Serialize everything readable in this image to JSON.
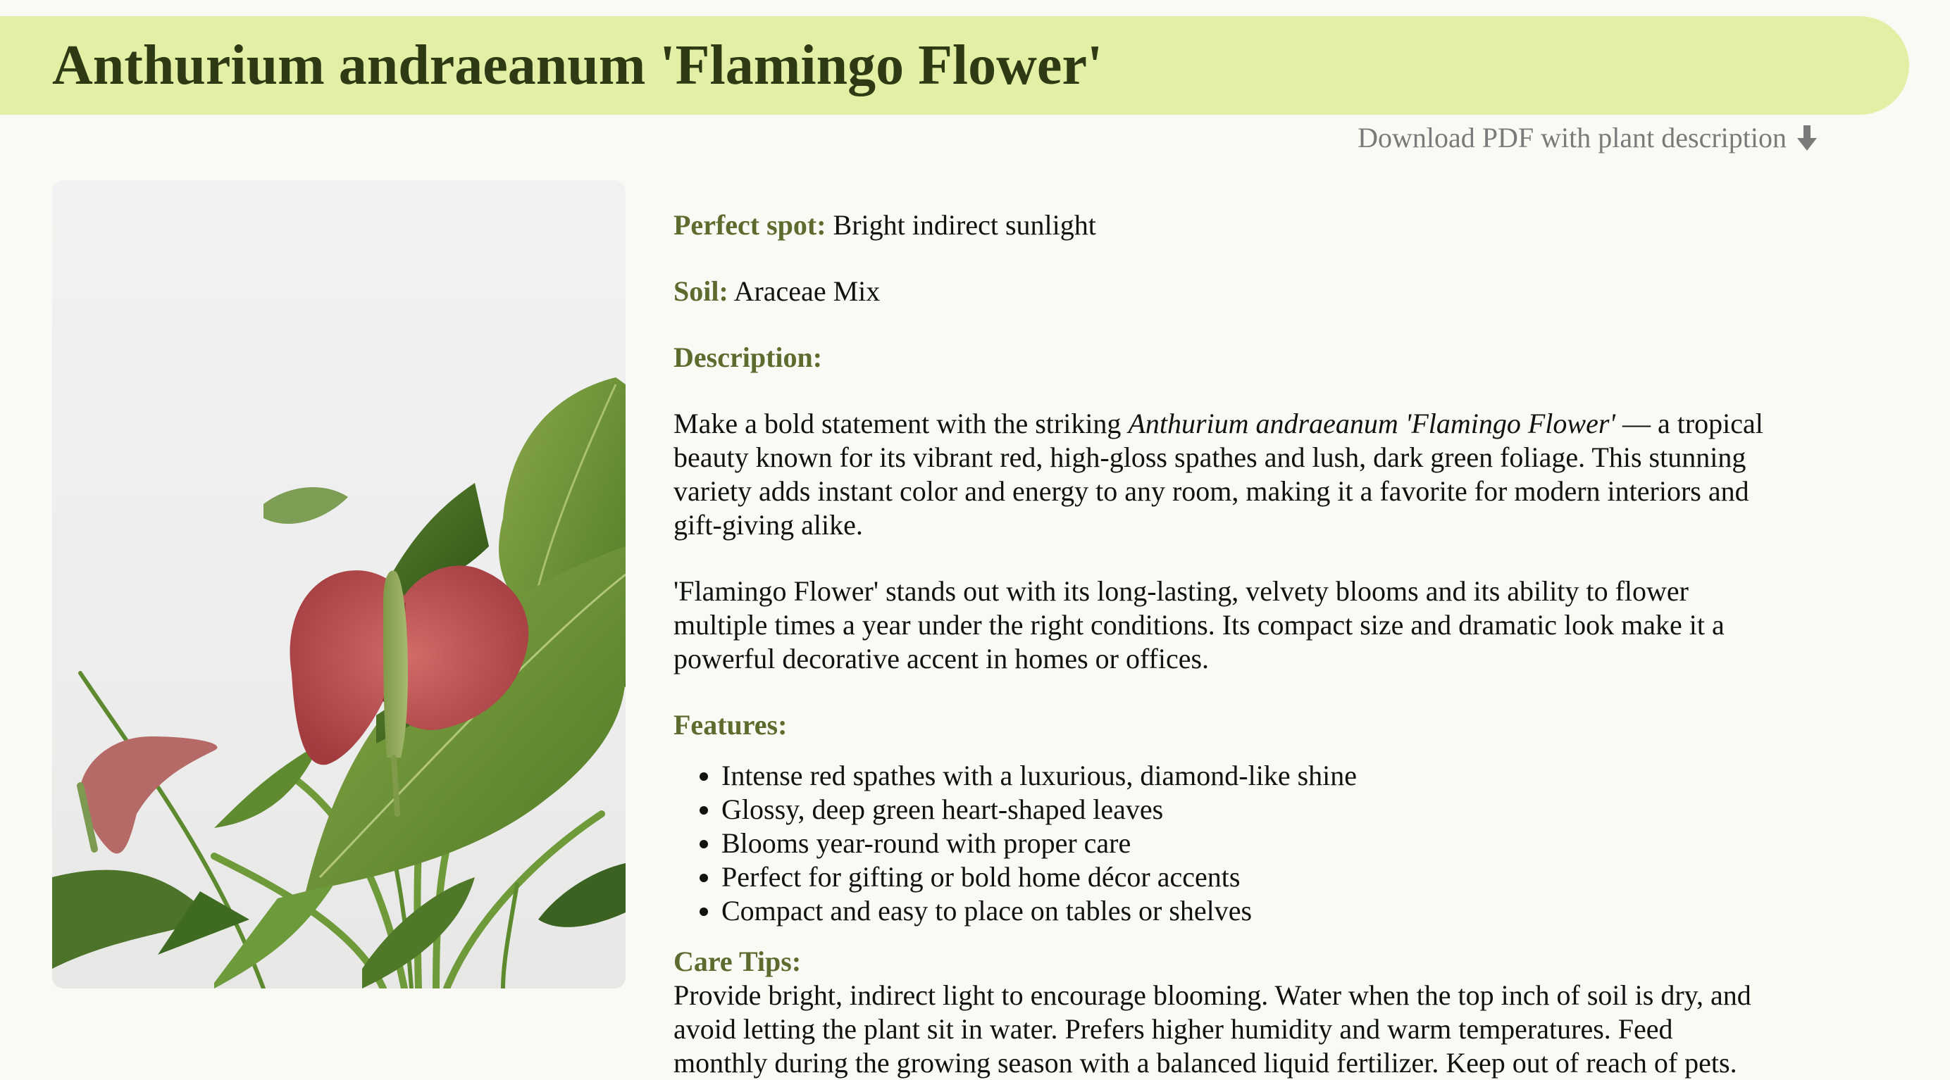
{
  "header": {
    "title": "Anthurium andraeanum 'Flamingo Flower'"
  },
  "download": {
    "label": "Download PDF with plant description",
    "icon": "download-arrow-icon"
  },
  "image": {
    "alt": "Anthurium plant with red spathe"
  },
  "details": {
    "spot_label": "Perfect spot:",
    "spot_value": " Bright indirect sunlight",
    "soil_label": "Soil:",
    "soil_value": " Araceae Mix",
    "description_label": "Description:",
    "description_p1_before": "Make a bold statement with the striking ",
    "description_p1_italic": "Anthurium andraeanum 'Flamingo Flower'",
    "description_p1_after": " — a tropical beauty known for its vibrant red, high-gloss spathes and lush, dark green foliage. This stunning variety adds instant color and energy to any room, making it a favorite for modern interiors and gift-giving alike.",
    "description_p2": "'Flamingo Flower' stands out with its long-lasting, velvety blooms and its ability to flower multiple times a year under the right conditions. Its compact size and dramatic look make it a powerful decorative accent in homes or offices.",
    "features_label": "Features:",
    "features": [
      "Intense red spathes with a luxurious, diamond-like shine",
      "Glossy, deep green heart-shaped leaves",
      "Blooms year-round with proper care",
      "Perfect for gifting or bold home décor accents",
      "Compact and easy to place on tables or shelves"
    ],
    "care_label": "Care Tips:",
    "care_text": "Provide bright, indirect light to encourage blooming. Water when the top inch of soil is dry, and avoid letting the plant sit in water. Prefers higher humidity and warm temperatures. Feed monthly during the growing season with a balanced liquid fertilizer. Keep out of reach of pets."
  },
  "colors": {
    "header_bg": "#e2efa4",
    "title": "#2e3a14",
    "label": "#5d6b2e",
    "page_bg": "#f9faf4",
    "link": "#7a7a7a"
  }
}
